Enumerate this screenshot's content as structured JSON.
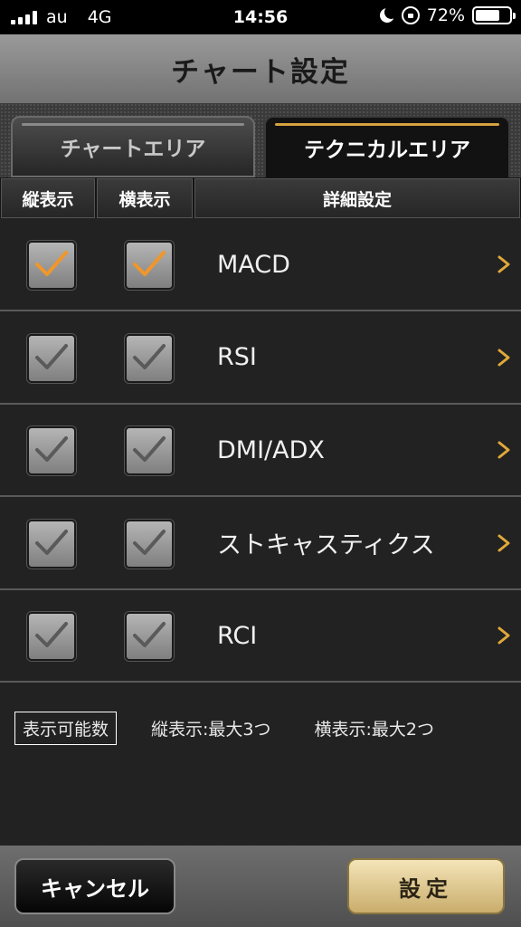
{
  "status_bar": {
    "carrier": "au",
    "network": "4G",
    "time": "14:56",
    "battery_percent": "72%",
    "battery_level": 0.72
  },
  "header": {
    "title": "チャート設定"
  },
  "tabs": [
    {
      "label": "チャートエリア",
      "selected": false
    },
    {
      "label": "テクニカルエリア",
      "selected": true
    }
  ],
  "columns": {
    "vertical": "縦表示",
    "horizontal": "横表示",
    "detail": "詳細設定"
  },
  "rows": [
    {
      "label": "MACD",
      "vertical_checked": true,
      "horizontal_checked": true
    },
    {
      "label": "RSI",
      "vertical_checked": false,
      "horizontal_checked": false
    },
    {
      "label": "DMI/ADX",
      "vertical_checked": false,
      "horizontal_checked": false
    },
    {
      "label": "ストキャスティクス",
      "vertical_checked": false,
      "horizontal_checked": false
    },
    {
      "label": "RCI",
      "vertical_checked": false,
      "horizontal_checked": false
    }
  ],
  "info": {
    "label": "表示可能数",
    "vertical_max": "縦表示:最大3つ",
    "horizontal_max": "横表示:最大2つ"
  },
  "footer": {
    "cancel_label": "キャンセル",
    "set_label": "設定"
  },
  "colors": {
    "check_active": "#f0962a",
    "check_inactive": "#5a5a5a",
    "arrow": "#e0a83a",
    "accent_gold": "#d6a23f"
  }
}
